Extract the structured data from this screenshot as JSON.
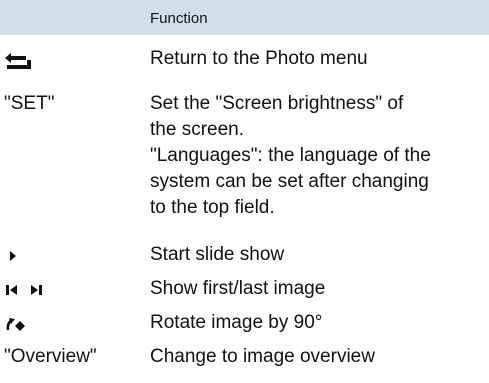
{
  "table": {
    "header": "Function",
    "rows": [
      {
        "control_icon": "return-arrow-icon",
        "function": "Return to the Photo menu"
      },
      {
        "control": "\"SET\"",
        "function_lines": [
          "Set the \"Screen brightness\" of",
          "the screen.",
          "\"Languages\": the language of the",
          "system can be set after changing",
          "to the top field."
        ]
      },
      {
        "control_icon": "play-icon",
        "function": "Start slide show"
      },
      {
        "control_icon": "first-last-image-icons",
        "function": "Show first/last image"
      },
      {
        "control_icon": "rotate-icon",
        "function": "Rotate image by 90°"
      },
      {
        "control": "\"Overview\"",
        "function": "Change to image overview"
      }
    ]
  },
  "colors": {
    "header_background": "#cfe0ec",
    "text": "#111111"
  }
}
